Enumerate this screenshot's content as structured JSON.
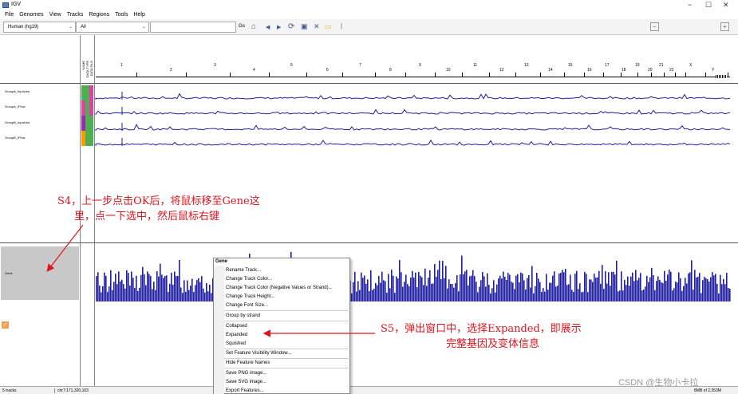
{
  "window": {
    "title": "IGV",
    "minimize": "−",
    "maximize": "☐",
    "close": "✕"
  },
  "menu": [
    "File",
    "Genomes",
    "View",
    "Tracks",
    "Regions",
    "Tools",
    "Help"
  ],
  "toolbar": {
    "genome": "Human (hg19)",
    "chromosome": "All",
    "locus_value": "",
    "go_label": "Go"
  },
  "attribute_headers": [
    "NAME",
    "DATA TYPE",
    "DATA FILE"
  ],
  "chromosomes": [
    "1",
    "2",
    "3",
    "4",
    "5",
    "6",
    "7",
    "8",
    "9",
    "10",
    "11",
    "12",
    "13",
    "14",
    "15",
    "16",
    "17",
    "18",
    "19",
    "20",
    "21",
    "22",
    "X",
    "Y"
  ],
  "tracks": [
    {
      "name": "GroupA_Input.bw"
    },
    {
      "name": "GroupA_IP.bw"
    },
    {
      "name": "GroupB_Input.bw"
    },
    {
      "name": "GroupB_IP.bw"
    }
  ],
  "feature_track": {
    "name": "Gene"
  },
  "context_menu": {
    "title": "Gene",
    "items": [
      "Rename Track...",
      "Change Track Color...",
      "Change Track Color (Negative Values or Strand)...",
      "Change Track Height...",
      "Change Font Size...",
      "Group by strand",
      "Collapsed",
      "Expanded",
      "Squished",
      "Set Feature Visibility Window...",
      "Hide Feature Names",
      "Save PNG image...",
      "Save SVG image...",
      "Export Features..."
    ],
    "checked": "Collapsed"
  },
  "annotations": {
    "s4_line1": "S4，上一步点击OK后，将鼠标移至Gene这",
    "s4_line2": "里，点一下选中，然后鼠标右键",
    "s5_line1": "S5，弹出窗口中，选择Expanded，即展示",
    "s5_line2": "完整基因及变体信息"
  },
  "status": {
    "tracks": "5 tracks",
    "position": "chr7:171,320,103",
    "memory": "8MB of 2,353M"
  },
  "watermark": "CSDN @生物小卡拉",
  "colors": {
    "track_blue": "#1f1fa0",
    "accent_red": "#e0141c",
    "attr_colors": [
      "#4caf50",
      "#e040a0",
      "#9c27b0",
      "#ff9800"
    ]
  }
}
